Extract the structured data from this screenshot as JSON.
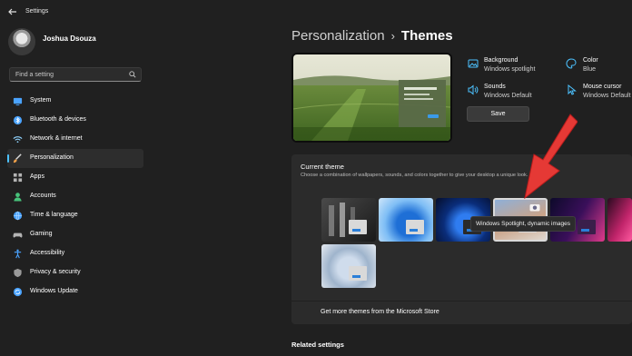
{
  "window": {
    "title": "Settings"
  },
  "profile": {
    "name": "Joshua Dsouza"
  },
  "search": {
    "placeholder": "Find a setting"
  },
  "sidebar": {
    "items": [
      {
        "label": "System",
        "icon": "monitor-icon",
        "color": "#4aa3ff"
      },
      {
        "label": "Bluetooth & devices",
        "icon": "bluetooth-icon",
        "color": "#4aa3ff"
      },
      {
        "label": "Network & internet",
        "icon": "wifi-icon",
        "color": "#8fd3ff"
      },
      {
        "label": "Personalization",
        "icon": "brush-icon",
        "color": "#f0a04a",
        "active": true
      },
      {
        "label": "Apps",
        "icon": "apps-icon",
        "color": "#b4b4b4"
      },
      {
        "label": "Accounts",
        "icon": "person-icon",
        "color": "#47c27a"
      },
      {
        "label": "Time & language",
        "icon": "globe-icon",
        "color": "#4aa3ff"
      },
      {
        "label": "Gaming",
        "icon": "controller-icon",
        "color": "#b4b4b4"
      },
      {
        "label": "Accessibility",
        "icon": "accessibility-icon",
        "color": "#4aa3ff"
      },
      {
        "label": "Privacy & security",
        "icon": "shield-icon",
        "color": "#9a9a9a"
      },
      {
        "label": "Windows Update",
        "icon": "update-icon",
        "color": "#4aa3ff"
      }
    ]
  },
  "breadcrumb": {
    "parent": "Personalization",
    "separator": "›",
    "current": "Themes"
  },
  "info": [
    {
      "title": "Background",
      "value": "Windows spotlight",
      "icon": "image-icon"
    },
    {
      "title": "Color",
      "value": "Blue",
      "icon": "palette-icon"
    },
    {
      "title": "Sounds",
      "value": "Windows Default",
      "icon": "speaker-icon"
    },
    {
      "title": "Mouse cursor",
      "value": "Windows Default",
      "icon": "cursor-icon"
    }
  ],
  "save_label": "Save",
  "current_theme": {
    "title": "Current theme",
    "description": "Choose a combination of wallpapers, sounds, and colors together to give your desktop a unique look.",
    "tooltip": "Windows Spotlight, dynamic images",
    "store_link": "Get more themes from the Microsoft Store"
  },
  "related_settings": "Related settings",
  "colors": {
    "accent": "#4cc2ff",
    "arrow": "#e53935",
    "background": "#202020",
    "panel": "#2b2b2b"
  }
}
